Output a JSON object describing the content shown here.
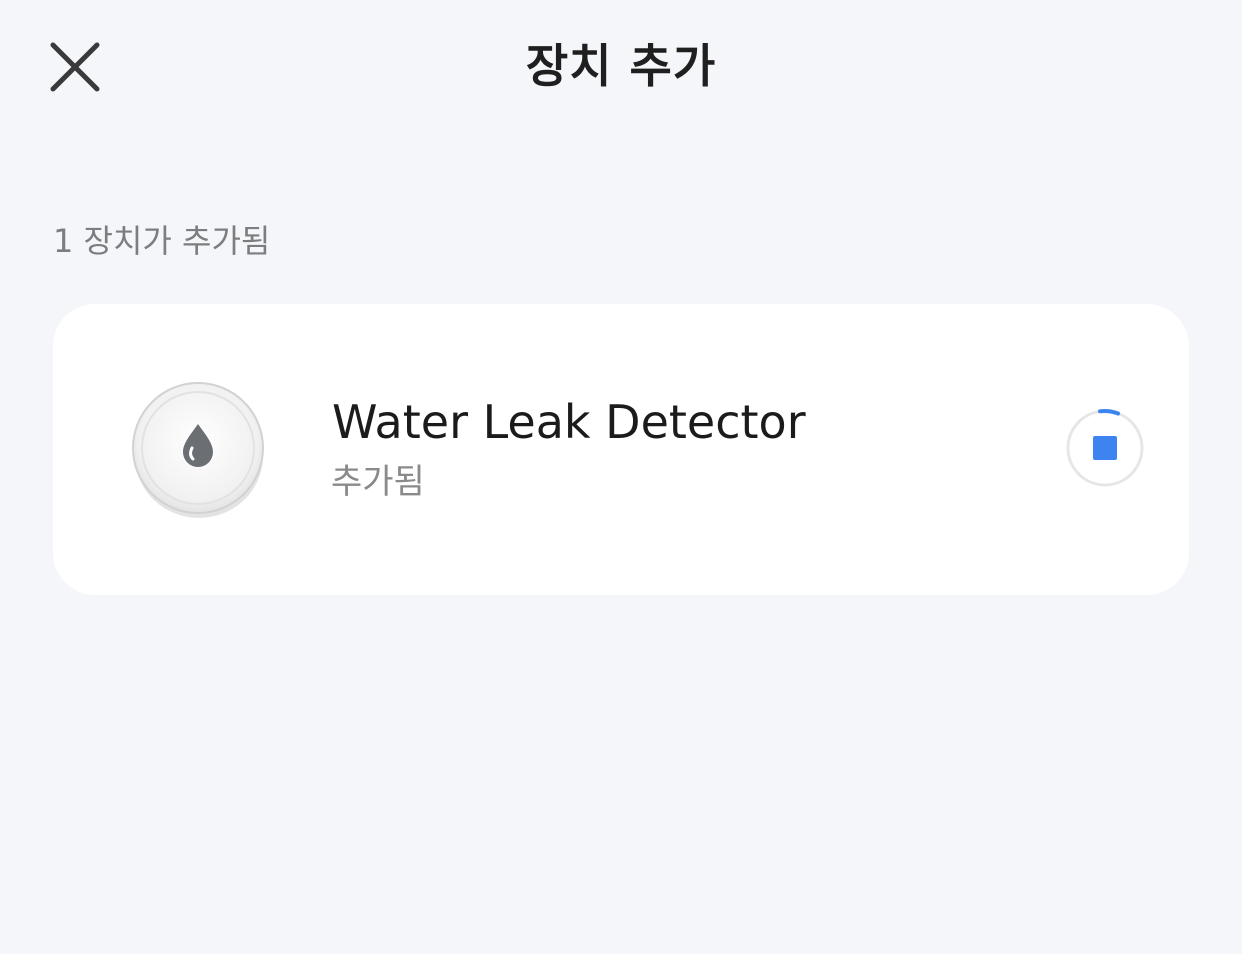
{
  "header": {
    "title": "장치 추가",
    "close_icon": "close-icon"
  },
  "summary": {
    "label": "1 장치가 추가됨"
  },
  "devices": [
    {
      "name": "Water Leak Detector",
      "status": "추가됨",
      "icon": "water-drop-icon",
      "action_icon": "stop-icon",
      "progress_color": "#3d84f0"
    }
  ],
  "colors": {
    "background": "#f5f6fa",
    "card": "#ffffff",
    "accent": "#3d84f0",
    "secondary_text": "#8a8a8c"
  }
}
